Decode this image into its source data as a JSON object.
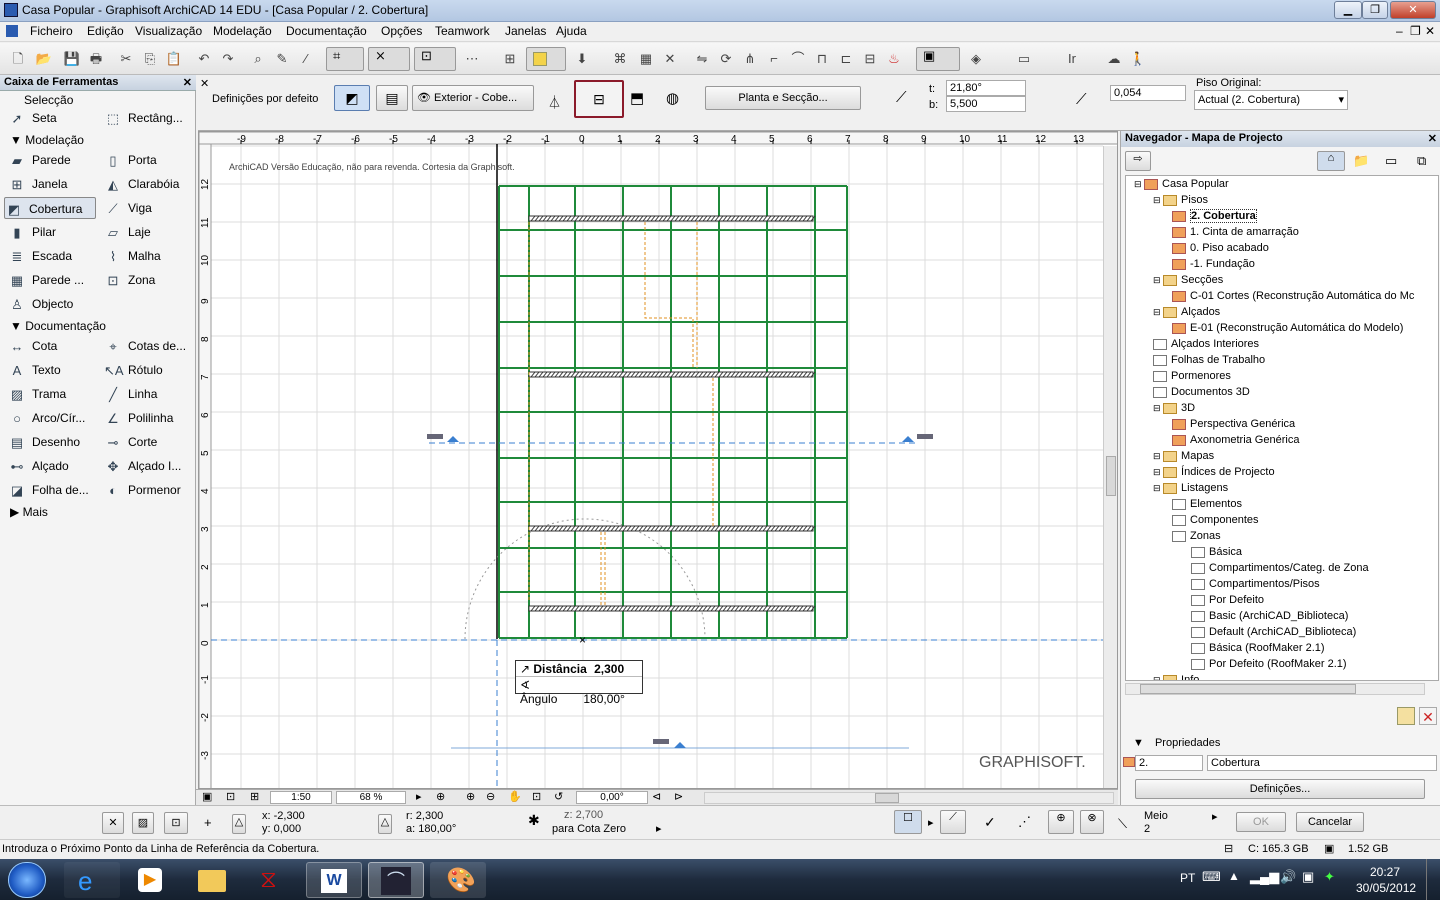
{
  "window": {
    "title": "Casa Popular - Graphisoft ArchiCAD 14 EDU - [Casa Popular / 2. Cobertura]"
  },
  "menu": [
    "Ficheiro",
    "Edição",
    "Visualização",
    "Modelação",
    "Documentação",
    "Opções",
    "Teamwork",
    "Janelas",
    "Ajuda"
  ],
  "toolbox": {
    "title": "Caixa de Ferramentas",
    "selection": "Selecção",
    "select_tools": [
      "Seta",
      "Rectâng..."
    ],
    "modeling_header": "Modelação",
    "modeling_tools": [
      "Parede",
      "Porta",
      "Janela",
      "Clarabóia",
      "Cobertura",
      "Viga",
      "Pilar",
      "Laje",
      "Escada",
      "Malha",
      "Parede ...",
      "Zona",
      "Objecto"
    ],
    "doc_header": "Documentação",
    "doc_tools": [
      "Cota",
      "Cotas de...",
      "Texto",
      "Rótulo",
      "Trama",
      "Linha",
      "Arco/Cír...",
      "Polilinha",
      "Desenho",
      "Corte",
      "Alçado",
      "Alçado I...",
      "Folha de...",
      "Pormenor"
    ],
    "more": "Mais"
  },
  "infobox": {
    "defaults_label": "Definições por defeito",
    "material": "Exterior - Cobe...",
    "plan_section": "Planta e Secção...",
    "t_label": "t:",
    "t_value": "21,80°",
    "b_label": "b:",
    "b_value": "5,500",
    "elev_value": "0,054",
    "home_story_label": "Piso Original:",
    "home_story_value": "Actual (2. Cobertura)"
  },
  "canvas": {
    "watermark": "ArchiCAD Versão Educação, não para revenda. Cortesia da Graphisoft.",
    "brand": "GRAPHISOFT.",
    "ruler_h": [
      "-9",
      "-8",
      "-7",
      "-6",
      "-5",
      "-4",
      "-3",
      "-2",
      "-1",
      "0",
      "1",
      "2",
      "3",
      "4",
      "5",
      "6",
      "7",
      "8",
      "9",
      "10",
      "11",
      "12",
      "13"
    ],
    "ruler_v": [
      "12",
      "11",
      "10",
      "9",
      "8",
      "7",
      "6",
      "5",
      "4",
      "3",
      "2",
      "1",
      "0",
      "-1",
      "-2",
      "-3"
    ],
    "tracker": {
      "dist_label": "Distância",
      "dist_value": "2,300",
      "angle_label": "Ângulo",
      "angle_value": "180,00°"
    }
  },
  "bottombar": {
    "scale": "1:50",
    "zoom": "68 %",
    "angle": "0,00°"
  },
  "navigator": {
    "title": "Navegador - Mapa de Projecto",
    "properties_label": "Propriedades",
    "prop_id": "2.",
    "prop_name": "Cobertura",
    "settings_button": "Definições...",
    "tree": [
      {
        "label": "Casa Popular",
        "level": 0,
        "icon": "house"
      },
      {
        "label": "Pisos",
        "level": 1,
        "icon": "folder"
      },
      {
        "label": "2. Cobertura",
        "level": 2,
        "icon": "story",
        "bold": true
      },
      {
        "label": "1. Cinta de amarração",
        "level": 2,
        "icon": "story"
      },
      {
        "label": "0. Piso acabado",
        "level": 2,
        "icon": "story"
      },
      {
        "label": "-1. Fundação",
        "level": 2,
        "icon": "story"
      },
      {
        "label": "Secções",
        "level": 1,
        "icon": "folder"
      },
      {
        "label": "C-01 Cortes (Reconstrução Automática do Mc",
        "level": 2,
        "icon": "house"
      },
      {
        "label": "Alçados",
        "level": 1,
        "icon": "folder"
      },
      {
        "label": "E-01 (Reconstrução Automática do Modelo)",
        "level": 2,
        "icon": "house"
      },
      {
        "label": "Alçados Interiores",
        "level": 1,
        "icon": "doc"
      },
      {
        "label": "Folhas de Trabalho",
        "level": 1,
        "icon": "doc"
      },
      {
        "label": "Pormenores",
        "level": 1,
        "icon": "doc"
      },
      {
        "label": "Documentos 3D",
        "level": 1,
        "icon": "doc"
      },
      {
        "label": "3D",
        "level": 1,
        "icon": "folder"
      },
      {
        "label": "Perspectiva Genérica",
        "level": 2,
        "icon": "cam"
      },
      {
        "label": "Axonometria Genérica",
        "level": 2,
        "icon": "cube"
      },
      {
        "label": "Mapas",
        "level": 1,
        "icon": "folder"
      },
      {
        "label": "Índices de Projecto",
        "level": 1,
        "icon": "folder"
      },
      {
        "label": "Listagens",
        "level": 1,
        "icon": "folder"
      },
      {
        "label": "Elementos",
        "level": 2,
        "icon": "list"
      },
      {
        "label": "Componentes",
        "level": 2,
        "icon": "list"
      },
      {
        "label": "Zonas",
        "level": 2,
        "icon": "list"
      },
      {
        "label": "Básica",
        "level": 3,
        "icon": "doc"
      },
      {
        "label": "Compartimentos/Categ. de Zona",
        "level": 3,
        "icon": "doc"
      },
      {
        "label": "Compartimentos/Pisos",
        "level": 3,
        "icon": "doc"
      },
      {
        "label": "Por Defeito",
        "level": 3,
        "icon": "doc"
      },
      {
        "label": "Basic (ArchiCAD_Biblioteca)",
        "level": 3,
        "icon": "doc"
      },
      {
        "label": "Default (ArchiCAD_Biblioteca)",
        "level": 3,
        "icon": "doc"
      },
      {
        "label": "Básica (RoofMaker 2.1)",
        "level": 3,
        "icon": "doc"
      },
      {
        "label": "Por Defeito (RoofMaker 2.1)",
        "level": 3,
        "icon": "doc"
      },
      {
        "label": "Info",
        "level": 1,
        "icon": "folder"
      }
    ]
  },
  "coords": {
    "x": "x: -2,300",
    "y": "y: 0,000",
    "r": "r: 2,300",
    "a": "a: 180,00°",
    "z": "z: 2,700",
    "z_ref": "para Cota Zero",
    "meio": "Meio",
    "meio_n": "2",
    "ok": "OK",
    "cancel": "Cancelar"
  },
  "status": {
    "prompt": "Introduza o Próximo Ponto da Linha de Referência da Cobertura.",
    "disk_c": "C: 165.3 GB",
    "mem": "1.52 GB"
  },
  "taskbar": {
    "lang": "PT",
    "time": "20:27",
    "date": "30/05/2012"
  },
  "colors": {
    "grid_green": "#1f8a3a",
    "dash_orange": "#e09020",
    "guide_blue": "#3a7fd0",
    "selection_red": "#8b1a2a"
  }
}
